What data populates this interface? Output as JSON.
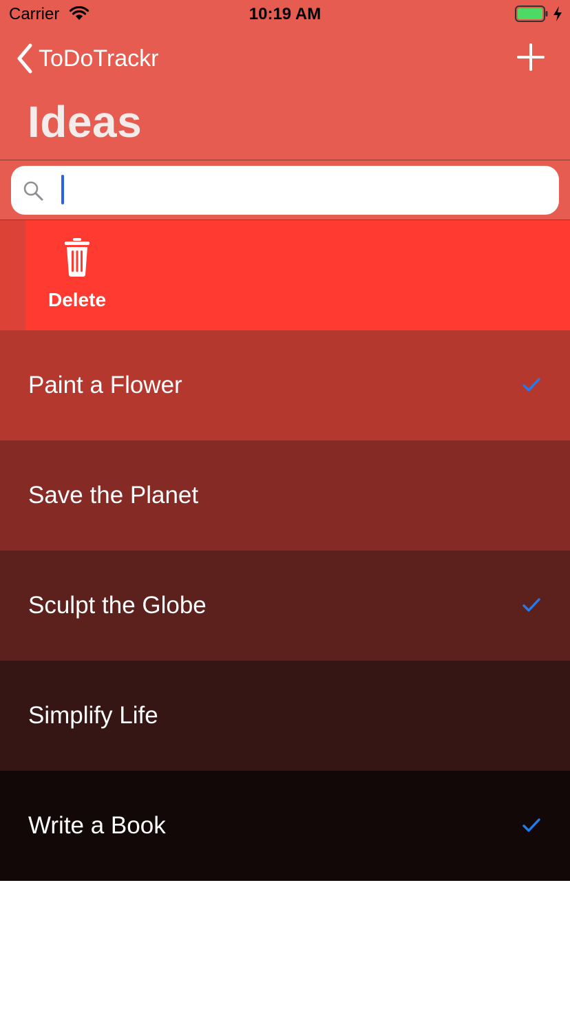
{
  "status_bar": {
    "carrier": "Carrier",
    "time": "10:19 AM",
    "battery_color": "#4cd964"
  },
  "nav": {
    "back_label": "ToDoTrackr",
    "title": "Ideas",
    "add_icon": "plus-icon"
  },
  "search": {
    "placeholder": "",
    "value": ""
  },
  "swipe_action": {
    "label": "Delete",
    "icon": "trash-icon",
    "color": "#ff3a30"
  },
  "items": [
    {
      "title": "Paint a Flower",
      "checked": true,
      "color": "#b5382f"
    },
    {
      "title": "Save the Planet",
      "checked": false,
      "color": "#852a24"
    },
    {
      "title": "Sculpt the Globe",
      "checked": true,
      "color": "#5c201d"
    },
    {
      "title": "Simplify Life",
      "checked": false,
      "color": "#351614"
    },
    {
      "title": "Write a Book",
      "checked": true,
      "color": "#130808"
    }
  ],
  "colors": {
    "header": "#e65c50",
    "checkmark": "#1e7cf5"
  }
}
